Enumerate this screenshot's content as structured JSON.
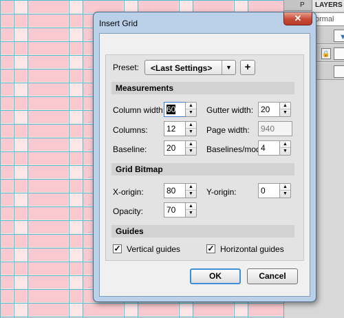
{
  "dialog": {
    "title": "Insert Grid",
    "close_glyph": "✕",
    "preset": {
      "label": "Preset:",
      "value": "<Last Settings>",
      "add_glyph": "+"
    },
    "measurements": {
      "heading": "Measurements",
      "column_width": {
        "label": "Column width:",
        "value": "60"
      },
      "gutter_width": {
        "label": "Gutter width:",
        "value": "20"
      },
      "columns": {
        "label": "Columns:",
        "value": "12"
      },
      "page_width": {
        "label": "Page width:",
        "value": "940"
      },
      "baseline": {
        "label": "Baseline:",
        "value": "20"
      },
      "baselines_mod": {
        "label": "Baselines/mod:",
        "value": "4"
      }
    },
    "grid_bitmap": {
      "heading": "Grid Bitmap",
      "x_origin": {
        "label": "X-origin:",
        "value": "80"
      },
      "y_origin": {
        "label": "Y-origin:",
        "value": "0"
      },
      "opacity": {
        "label": "Opacity:",
        "value": "70"
      }
    },
    "guides": {
      "heading": "Guides",
      "vertical": {
        "label": "Vertical guides",
        "checked": true
      },
      "horizontal": {
        "label": "Horizontal guides",
        "checked": true
      }
    },
    "ok_label": "OK",
    "cancel_label": "Cancel"
  },
  "panel": {
    "tab_partial": "P",
    "tab_layers": "LAYERS",
    "blend_mode_partial": "ormal"
  },
  "colors": {
    "grid_fill": "#f9c9cf",
    "grid_light": "#fde6e8",
    "grid_line": "#49c3d3",
    "ok_border": "#3c8fd6"
  }
}
